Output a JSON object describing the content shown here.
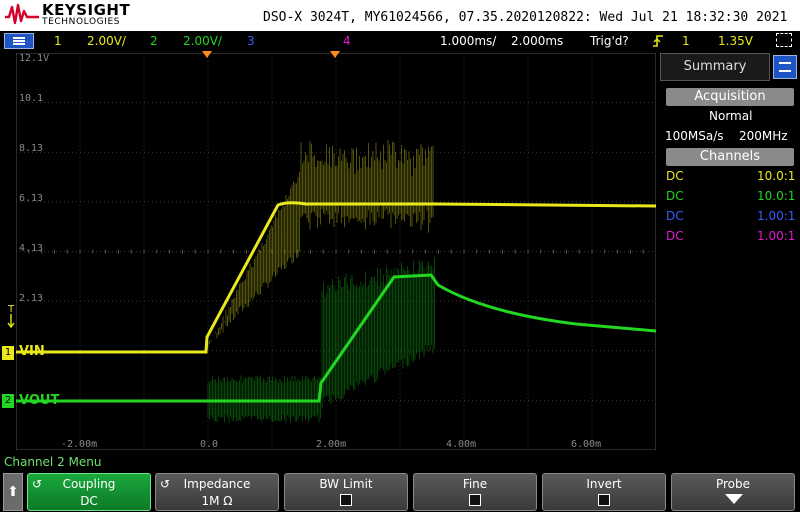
{
  "header": {
    "brand": "KEYSIGHT",
    "brand_sub": "TECHNOLOGIES",
    "title": "DSO-X 3024T, MY61024566, 07.35.2020120822: Wed Jul 21 18:32:30 2021"
  },
  "status": {
    "ch1_num": "1",
    "ch1_scale": "2.00V/",
    "ch2_num": "2",
    "ch2_scale": "2.00V/",
    "ch3_num": "3",
    "ch4_num": "4",
    "time_pos": "1.000ms/",
    "time_scale": "2.000ms",
    "trig_state": "Trig'd?",
    "trig_icon": "trigger-edge-icon",
    "trig_ch": "1",
    "trig_level": "1.35V"
  },
  "graticule": {
    "y_labels": [
      "12.1V",
      "10.1",
      "8.13",
      "6.13",
      "4.13",
      "2.13",
      "T"
    ],
    "x_labels": [
      "-2.00m",
      "0.0",
      "2.00m",
      "4.00m",
      "6.00m"
    ]
  },
  "channels": {
    "ch1_label": "VIN",
    "ch2_label": "VOUT",
    "ch1_marker": "1",
    "ch2_marker": "2"
  },
  "colors": {
    "ch1": "#e8e81a",
    "ch2": "#22d622",
    "ch3": "#3a5cff",
    "ch4": "#e01ad0",
    "marker": "#ff8c1a"
  },
  "panel": {
    "tab": "Summary",
    "acq_head": "Acquisition",
    "acq_mode": "Normal",
    "sample_rate": "100MSa/s",
    "bandwidth": "200MHz",
    "ch_head": "Channels",
    "channels": [
      {
        "coupling": "DC",
        "probe": "10.0:1"
      },
      {
        "coupling": "DC",
        "probe": "10.0:1"
      },
      {
        "coupling": "DC",
        "probe": "1.00:1"
      },
      {
        "coupling": "DC",
        "probe": "1.00:1"
      }
    ]
  },
  "menu": {
    "title": "Channel 2 Menu",
    "keys": [
      {
        "label": "Coupling",
        "value": "DC"
      },
      {
        "label": "Impedance",
        "value": "1M Ω"
      },
      {
        "label": "BW Limit"
      },
      {
        "label": "Fine"
      },
      {
        "label": "Invert"
      },
      {
        "label": "Probe"
      }
    ]
  }
}
